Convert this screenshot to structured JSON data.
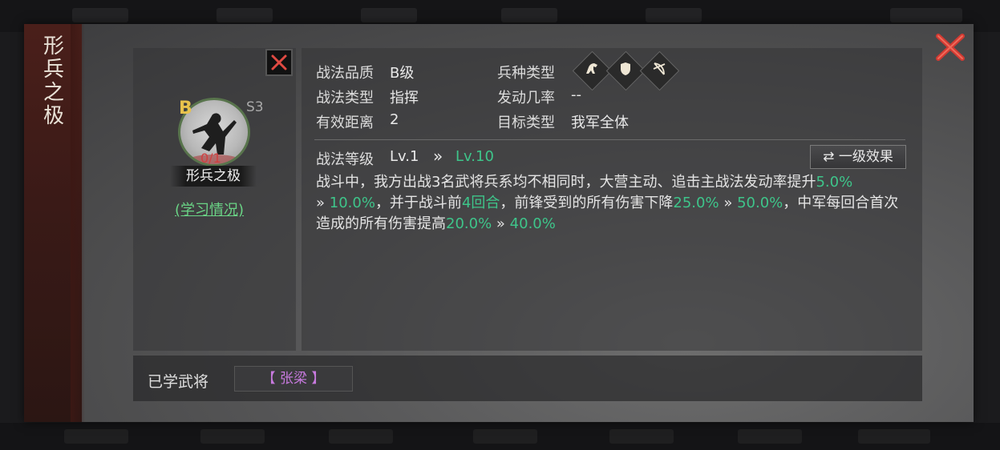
{
  "skill": {
    "title": "形兵之极",
    "grade": "B",
    "season": "S3",
    "count": "0/1",
    "name": "形兵之极",
    "study_link": "(学习情况)"
  },
  "info": {
    "quality_label": "战法品质",
    "quality_value": "B级",
    "type_label": "战法类型",
    "type_value": "指挥",
    "range_label": "有效距离",
    "range_value": "2",
    "troop_label": "兵种类型",
    "rate_label": "发动几率",
    "rate_value": "--",
    "target_label": "目标类型",
    "target_value": "我军全体",
    "troop_icons": [
      "cavalry-icon",
      "shield-icon",
      "bow-icon"
    ]
  },
  "level": {
    "label": "战法等级",
    "from": "Lv.1",
    "arrow": "»",
    "to": "Lv.10",
    "effect_button": "一级效果",
    "effect_button_icon": "⇄"
  },
  "description": {
    "p1": "战斗中，我方出战3名武将兵系均不相同时，大营主动、追击主战法发动率提升",
    "v1a": "5.0%",
    "arrow": "»",
    "v1b": "10.0%",
    "p2": "，并于战斗前",
    "v2": "4回合",
    "p3": "，前锋受到的所有伤害下降",
    "v3a": "25.0%",
    "v3b": "50.0%",
    "p4": "，中军每回合首次造成的所有伤害提高",
    "v4a": "20.0%",
    "v4b": "40.0%"
  },
  "learned": {
    "label": "已学武将",
    "general": "【 张梁 】"
  },
  "colors": {
    "accent_green": "#3ec58a",
    "close_red": "#d23a32",
    "grade_gold": "#e8c24c",
    "general_purple": "#c87adf"
  }
}
